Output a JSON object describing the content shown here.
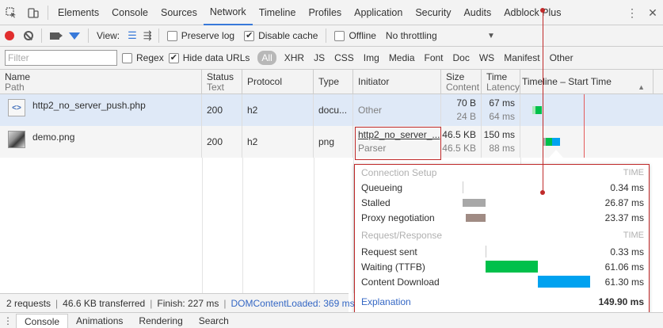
{
  "tabbar": {
    "tabs": [
      "Elements",
      "Console",
      "Sources",
      "Network",
      "Timeline",
      "Profiles",
      "Application",
      "Security",
      "Audits",
      "Adblock Plus"
    ],
    "active": "Network"
  },
  "toolbar": {
    "view_label": "View:",
    "preserve_log": "Preserve log",
    "disable_cache": "Disable cache",
    "offline": "Offline",
    "throttling": "No throttling"
  },
  "filterbar": {
    "placeholder": "Filter",
    "regex": "Regex",
    "hide_data_urls": "Hide data URLs",
    "types": [
      "All",
      "XHR",
      "JS",
      "CSS",
      "Img",
      "Media",
      "Font",
      "Doc",
      "WS",
      "Manifest",
      "Other"
    ]
  },
  "columns": {
    "name": "Name",
    "name_sub": "Path",
    "status": "Status",
    "status_sub": "Text",
    "protocol": "Protocol",
    "type": "Type",
    "initiator": "Initiator",
    "size": "Size",
    "size_sub": "Content",
    "time": "Time",
    "time_sub": "Latency",
    "timeline": "Timeline – Start Time"
  },
  "rows": [
    {
      "name": "http2_no_server_push.php",
      "status": "200",
      "protocol": "h2",
      "type": "docu...",
      "initiator": "Other",
      "initiator_sub": "",
      "size": "70 B",
      "size_sub": "24 B",
      "time": "67 ms",
      "time_sub": "64 ms"
    },
    {
      "name": "demo.png",
      "status": "200",
      "protocol": "h2",
      "type": "png",
      "initiator": "http2_no_server_...",
      "initiator_sub": "Parser",
      "size": "46.5 KB",
      "size_sub": "46.5 KB",
      "time": "150 ms",
      "time_sub": "88 ms"
    }
  ],
  "timing": {
    "connection_setup": "Connection Setup",
    "request_response": "Request/Response",
    "time_header": "TIME",
    "items": [
      {
        "label": "Queueing",
        "time": "0.34 ms"
      },
      {
        "label": "Stalled",
        "time": "26.87 ms"
      },
      {
        "label": "Proxy negotiation",
        "time": "23.37 ms"
      },
      {
        "label": "Request sent",
        "time": "0.33 ms"
      },
      {
        "label": "Waiting (TTFB)",
        "time": "61.06 ms"
      },
      {
        "label": "Content Download",
        "time": "61.30 ms"
      }
    ],
    "explanation": "Explanation",
    "total": "149.90 ms"
  },
  "status": {
    "requests": "2 requests",
    "transferred": "46.6 KB transferred",
    "finish": "Finish: 227 ms",
    "dcl": "DOMContentLoaded: 369 ms"
  },
  "drawer": {
    "tabs": [
      "Console",
      "Animations",
      "Rendering",
      "Search"
    ]
  },
  "colors": {
    "accent": "#3879d9",
    "record": "#e12e2e",
    "ttfb": "#00c04b",
    "download": "#00a2f0",
    "stalled": "#a8a8a8",
    "proxy": "#a08b84",
    "annotation": "#c02a2a"
  }
}
